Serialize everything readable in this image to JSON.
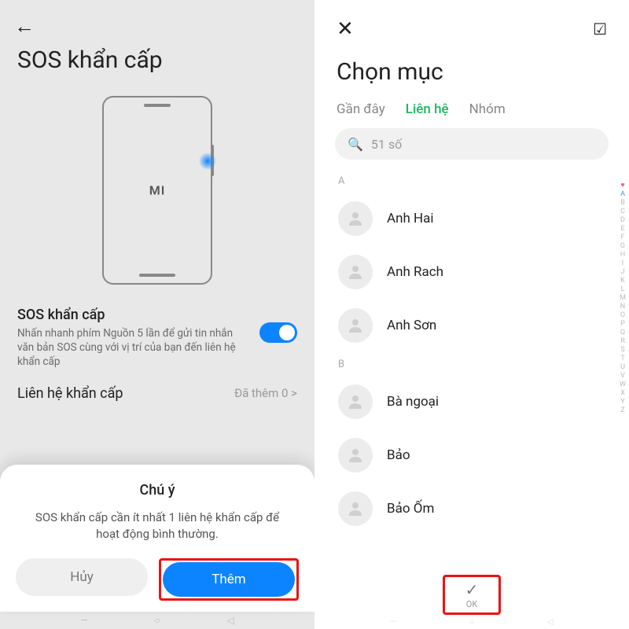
{
  "left": {
    "title": "SOS khẩn cấp",
    "phone_logo": "MI",
    "setting": {
      "title": "SOS khẩn cấp",
      "desc": "Nhấn nhanh phím Nguồn 5 lần để gửi tin nhắn văn bản SOS cùng với vị trí của bạn đến liên hệ khẩn cấp"
    },
    "link": {
      "label": "Liên hệ khẩn cấp",
      "value": "Đã thêm 0 >"
    },
    "sheet": {
      "title": "Chú ý",
      "desc": "SOS khẩn cấp cần ít nhất 1 liên hệ khẩn cấp để hoạt động bình thường.",
      "cancel": "Hủy",
      "confirm": "Thêm"
    }
  },
  "right": {
    "title": "Chọn mục",
    "tabs": {
      "recent": "Gần đây",
      "contacts": "Liên hệ",
      "groups": "Nhóm"
    },
    "search_placeholder": "51 số",
    "sections": {
      "a_letter": "A",
      "a": [
        "Anh Hai",
        "Anh Rach",
        "Anh Sơn"
      ],
      "b_letter": "B",
      "b": [
        "Bà ngoại",
        "Bảo",
        "Bảo Ốm"
      ]
    },
    "alpha": [
      "A",
      "B",
      "C",
      "D",
      "E",
      "F",
      "G",
      "H",
      "I",
      "J",
      "K",
      "L",
      "M",
      "N",
      "O",
      "P",
      "Q",
      "R",
      "S",
      "T",
      "U",
      "V",
      "W",
      "X",
      "Y",
      "Z"
    ],
    "ok_label": "OK"
  }
}
